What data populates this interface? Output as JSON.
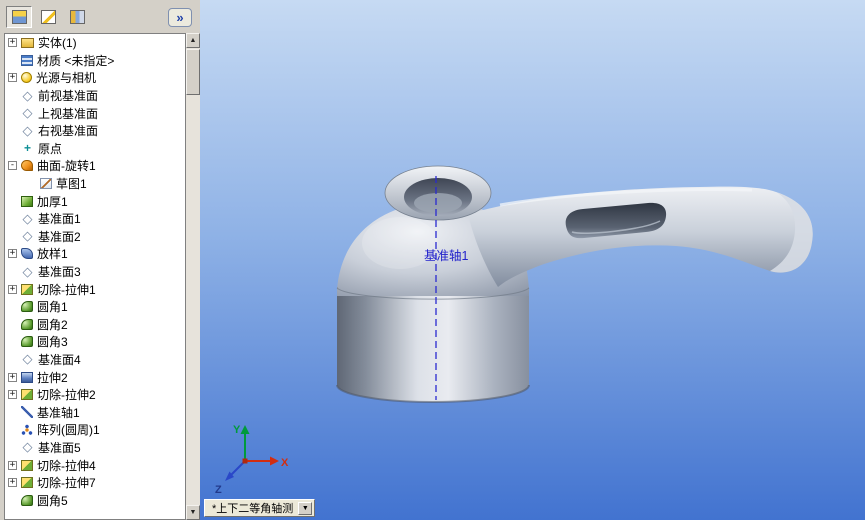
{
  "panel": {
    "toolbar": {
      "tabs": [
        {
          "name": "featuremanager"
        },
        {
          "name": "propertymanager"
        },
        {
          "name": "configurationmanager"
        }
      ],
      "collapse_label": "»"
    },
    "tree": {
      "items": [
        {
          "label": "实体(1)",
          "icon": "solid-bodies-folder",
          "expand": "+"
        },
        {
          "label": "材质 <未指定>",
          "icon": "material"
        },
        {
          "label": "光源与相机",
          "icon": "lights-cameras",
          "expand": "+"
        },
        {
          "label": "前视基准面",
          "icon": "plane"
        },
        {
          "label": "上视基准面",
          "icon": "plane"
        },
        {
          "label": "右视基准面",
          "icon": "plane"
        },
        {
          "label": "原点",
          "icon": "origin"
        },
        {
          "label": "曲面-旋转1",
          "icon": "surface-revolve",
          "expand": "-"
        },
        {
          "label": "草图1",
          "icon": "sketch",
          "indent": 1
        },
        {
          "label": "加厚1",
          "icon": "thicken"
        },
        {
          "label": "基准面1",
          "icon": "plane"
        },
        {
          "label": "基准面2",
          "icon": "plane"
        },
        {
          "label": "放样1",
          "icon": "loft",
          "expand": "+"
        },
        {
          "label": "基准面3",
          "icon": "plane"
        },
        {
          "label": "切除-拉伸1",
          "icon": "cut-extrude",
          "expand": "+"
        },
        {
          "label": "圆角1",
          "icon": "fillet"
        },
        {
          "label": "圆角2",
          "icon": "fillet"
        },
        {
          "label": "圆角3",
          "icon": "fillet"
        },
        {
          "label": "基准面4",
          "icon": "plane"
        },
        {
          "label": "拉伸2",
          "icon": "extrude",
          "expand": "+"
        },
        {
          "label": "切除-拉伸2",
          "icon": "cut-extrude",
          "expand": "+"
        },
        {
          "label": "基准轴1",
          "icon": "axis"
        },
        {
          "label": "阵列(圆周)1",
          "icon": "circular-pattern"
        },
        {
          "label": "基准面5",
          "icon": "plane"
        },
        {
          "label": "切除-拉伸4",
          "icon": "cut-extrude",
          "expand": "+"
        },
        {
          "label": "切除-拉伸7",
          "icon": "cut-extrude",
          "expand": "+"
        },
        {
          "label": "圆角5",
          "icon": "fillet"
        }
      ]
    }
  },
  "viewport": {
    "axis_label": "基准轴1",
    "triad": {
      "x": "X",
      "y": "Y",
      "z": "Z"
    },
    "view_selector": {
      "label": "*上下二等角轴测",
      "dropdown_icon": "▼"
    },
    "colors": {
      "sky_top": "#c6daf3",
      "sky_bottom": "#4273d0",
      "model_gray": "#c9d0da",
      "axis_blue": "#2222cc",
      "triad_x_red": "#d22d10",
      "triad_y_green": "#009a3c",
      "triad_z_blue": "#2a48c8"
    }
  }
}
